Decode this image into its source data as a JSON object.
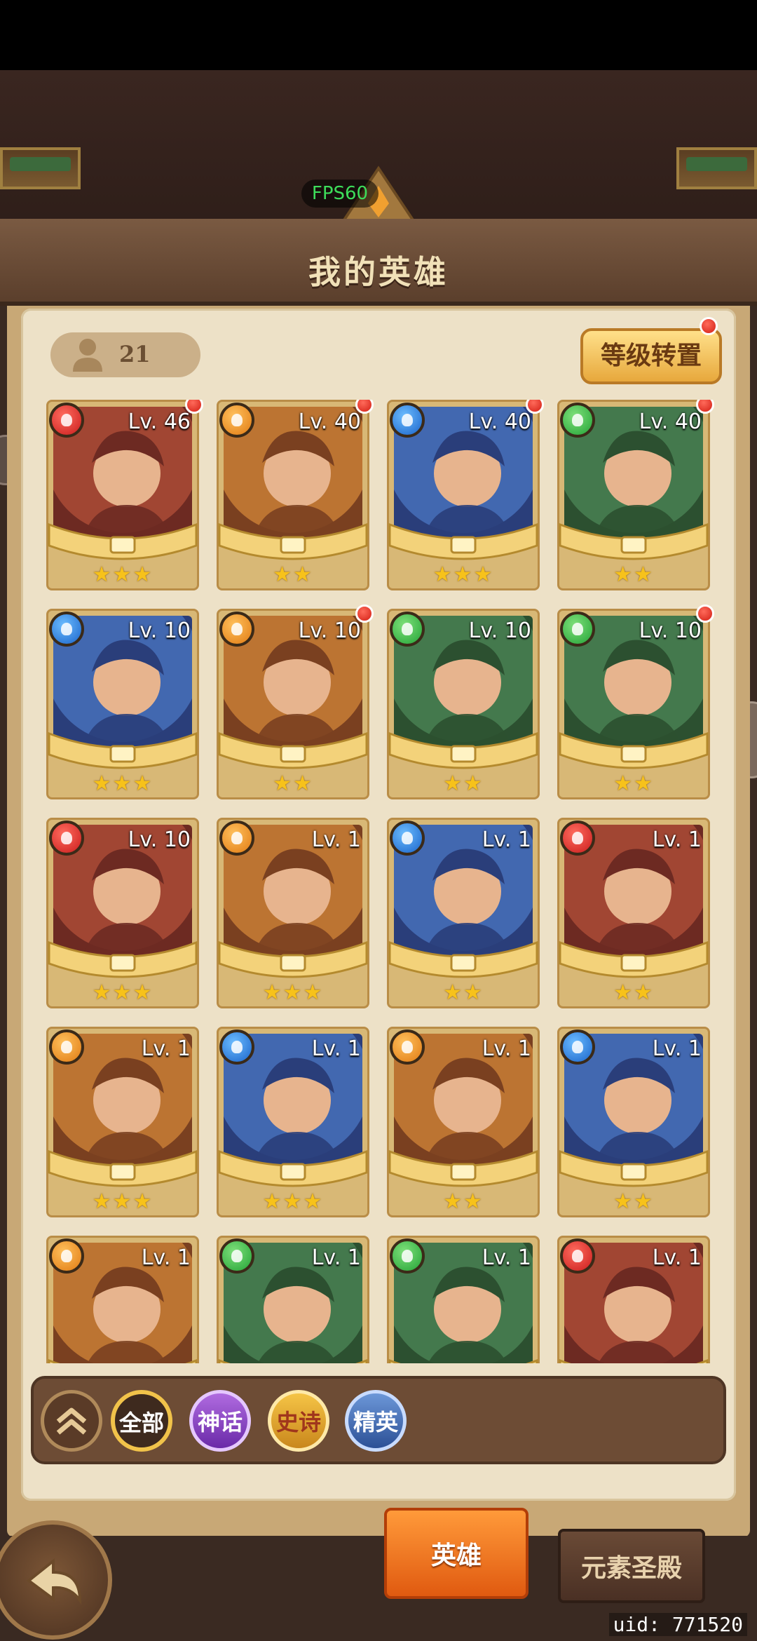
{
  "hud": {
    "fps": "FPS60",
    "uid": "uid: 771520"
  },
  "header": {
    "title": "我的英雄"
  },
  "roster": {
    "count": "21",
    "transfer_label": "等级转置"
  },
  "colors": {
    "fire": "#d21e14",
    "light": "#e07a12",
    "water": "#1a63c9",
    "earth": "#23a236",
    "accent": "#f1c34a",
    "tab_active": "#e05a10"
  },
  "heroes": [
    {
      "level": "Lv. 46",
      "element": "fire",
      "stars": "★★★",
      "new": true
    },
    {
      "level": "Lv. 40",
      "element": "light",
      "stars": "★★",
      "new": true
    },
    {
      "level": "Lv. 40",
      "element": "water",
      "stars": "★★★",
      "new": true
    },
    {
      "level": "Lv. 40",
      "element": "earth",
      "stars": "★★",
      "new": true
    },
    {
      "level": "Lv. 10",
      "element": "water",
      "stars": "★★★",
      "new": false
    },
    {
      "level": "Lv. 10",
      "element": "light",
      "stars": "★★",
      "new": true
    },
    {
      "level": "Lv. 10",
      "element": "earth",
      "stars": "★★",
      "new": false
    },
    {
      "level": "Lv. 10",
      "element": "earth",
      "stars": "★★",
      "new": true
    },
    {
      "level": "Lv. 10",
      "element": "fire",
      "stars": "★★★",
      "new": false
    },
    {
      "level": "Lv. 1",
      "element": "light",
      "stars": "★★★",
      "new": false
    },
    {
      "level": "Lv. 1",
      "element": "water",
      "stars": "★★",
      "new": false
    },
    {
      "level": "Lv. 1",
      "element": "fire",
      "stars": "★★",
      "new": false
    },
    {
      "level": "Lv. 1",
      "element": "light",
      "stars": "★★★",
      "new": false
    },
    {
      "level": "Lv. 1",
      "element": "water",
      "stars": "★★★",
      "new": false
    },
    {
      "level": "Lv. 1",
      "element": "light",
      "stars": "★★",
      "new": false
    },
    {
      "level": "Lv. 1",
      "element": "water",
      "stars": "★★",
      "new": false
    },
    {
      "level": "Lv. 1",
      "element": "light",
      "stars": "",
      "new": false
    },
    {
      "level": "Lv. 1",
      "element": "earth",
      "stars": "",
      "new": false
    },
    {
      "level": "Lv. 1",
      "element": "earth",
      "stars": "",
      "new": false
    },
    {
      "level": "Lv. 1",
      "element": "fire",
      "stars": "",
      "new": false
    }
  ],
  "filters": {
    "all": "全部",
    "myth": "神话",
    "epic": "史诗",
    "elite": "精英"
  },
  "tabs": {
    "heroes": "英雄",
    "temple": "元素圣殿"
  }
}
